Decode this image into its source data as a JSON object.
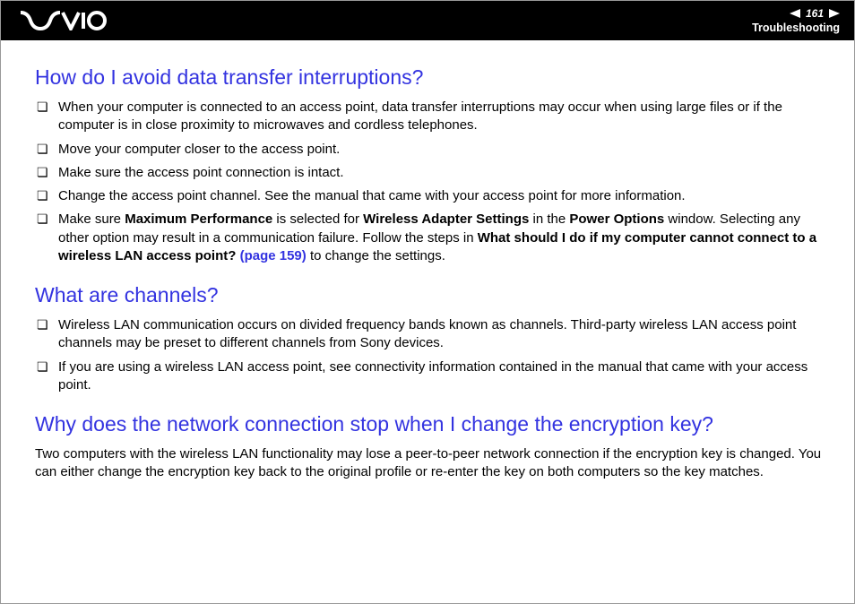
{
  "header": {
    "page_number": "161",
    "section": "Troubleshooting"
  },
  "q1": {
    "heading": "How do I avoid data transfer interruptions?",
    "items": [
      {
        "text": "When your computer is connected to an access point, data transfer interruptions may occur when using large files or if the computer is in close proximity to microwaves and cordless telephones."
      },
      {
        "text": "Move your computer closer to the access point."
      },
      {
        "text": "Make sure the access point connection is intact."
      },
      {
        "text": "Change the access point channel. See the manual that came with your access point for more information."
      }
    ],
    "item5": {
      "pre": "Make sure ",
      "b1": "Maximum Performance",
      "mid1": " is selected for ",
      "b2": "Wireless Adapter Settings",
      "mid2": " in the ",
      "b3": "Power Options",
      "mid3": " window. Selecting any other option may result in a communication failure. Follow the steps in ",
      "b4": "What should I do if my computer cannot connect to a wireless LAN access point? ",
      "link": "(page 159)",
      "post": " to change the settings."
    }
  },
  "q2": {
    "heading": "What are channels?",
    "items": [
      {
        "text": "Wireless LAN communication occurs on divided frequency bands known as channels. Third-party wireless LAN access point channels may be preset to different channels from Sony devices."
      },
      {
        "text": "If you are using a wireless LAN access point, see connectivity information contained in the manual that came with your access point."
      }
    ]
  },
  "q3": {
    "heading": "Why does the network connection stop when I change the encryption key?",
    "body": "Two computers with the wireless LAN functionality may lose a peer-to-peer network connection if the encryption key is changed. You can either change the encryption key back to the original profile or re-enter the key on both computers so the key matches."
  }
}
